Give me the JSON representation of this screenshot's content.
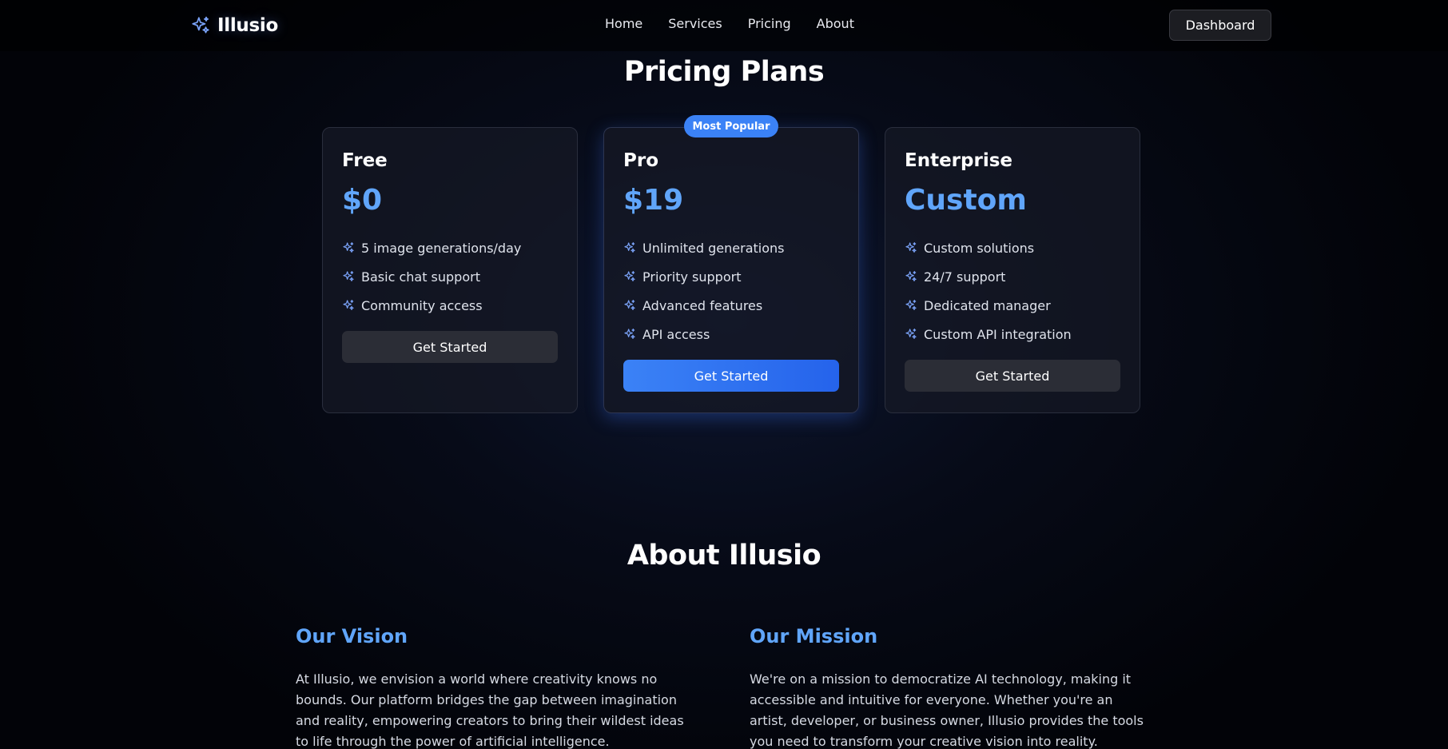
{
  "nav": {
    "brand": "Illusio",
    "links": [
      "Home",
      "Services",
      "Pricing",
      "About"
    ],
    "dashboard_label": "Dashboard"
  },
  "pricing": {
    "title": "Pricing Plans",
    "badge": "Most Popular",
    "plans": [
      {
        "name": "Free",
        "price": "$0",
        "features": [
          "5 image generations/day",
          "Basic chat support",
          "Community access"
        ],
        "cta": "Get Started"
      },
      {
        "name": "Pro",
        "price": "$19",
        "features": [
          "Unlimited generations",
          "Priority support",
          "Advanced features",
          "API access"
        ],
        "cta": "Get Started"
      },
      {
        "name": "Enterprise",
        "price": "Custom",
        "features": [
          "Custom solutions",
          "24/7 support",
          "Dedicated manager",
          "Custom API integration"
        ],
        "cta": "Get Started"
      }
    ]
  },
  "about": {
    "title": "About Illusio",
    "vision_title": "Our Vision",
    "vision_text": "At Illusio, we envision a world where creativity knows no bounds. Our platform bridges the gap between imagination and reality, empowering creators to bring their wildest ideas to life through the power of artificial intelligence.",
    "mission_title": "Our Mission",
    "mission_text": "We're on a mission to democratize AI technology, making it accessible and intuitive for everyone. Whether you're an artist, developer, or business owner, Illusio provides the tools you need to transform your creative vision into reality."
  },
  "colors": {
    "accent": "#60a5fa",
    "primary_button": "#3b82f6",
    "background": "#03050a"
  },
  "icons": {
    "brand": "sparkles-icon",
    "feature": "sparkles-icon"
  }
}
